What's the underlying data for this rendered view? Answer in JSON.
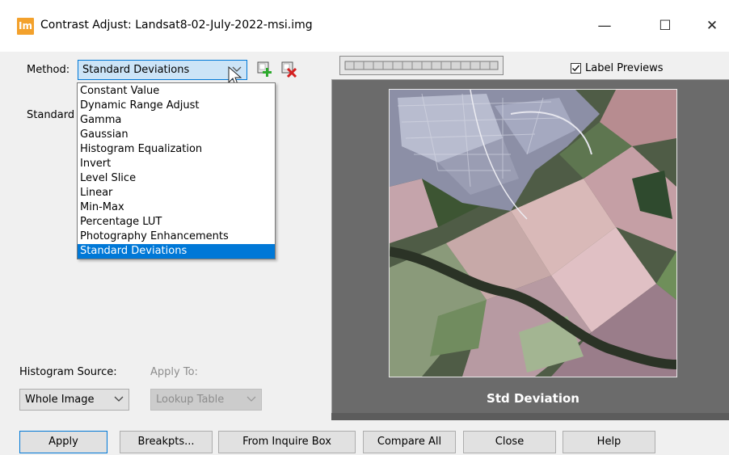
{
  "window": {
    "app_icon_text": "Im",
    "title": "Contrast Adjust: Landsat8-02-July-2022-msi.img",
    "minimize_glyph": "—",
    "maximize_glyph": "☐",
    "close_glyph": "✕"
  },
  "method": {
    "label": "Method:",
    "selected": "Standard Deviations",
    "options": [
      "Constant Value",
      "Dynamic Range Adjust",
      "Gamma",
      "Gaussian",
      "Histogram Equalization",
      "Invert",
      "Level Slice",
      "Linear",
      "Min-Max",
      "Percentage LUT",
      "Photography Enhancements",
      "Standard Deviations"
    ],
    "highlighted_index": 11
  },
  "std_label_partial": "Standard",
  "histogram_source": {
    "label": "Histogram Source:",
    "value": "Whole Image"
  },
  "apply_to": {
    "label": "Apply To:",
    "value": "Lookup Table",
    "disabled": true
  },
  "label_previews": {
    "label": "Label Previews",
    "checked": true
  },
  "preview": {
    "caption": "Std Deviation"
  },
  "buttons": {
    "apply": "Apply",
    "breakpts": "Breakpts...",
    "from_inquire_box": "From Inquire Box",
    "compare_all": "Compare All",
    "close": "Close",
    "help": "Help"
  },
  "icons": {
    "add": "add-green-plus-icon",
    "delete": "delete-red-x-icon",
    "dropdown": "chevron-down-icon"
  },
  "colors": {
    "accent": "#0078d7",
    "app_icon": "#f3a12c",
    "add_green": "#2eaa2e",
    "delete_red": "#d42020"
  }
}
